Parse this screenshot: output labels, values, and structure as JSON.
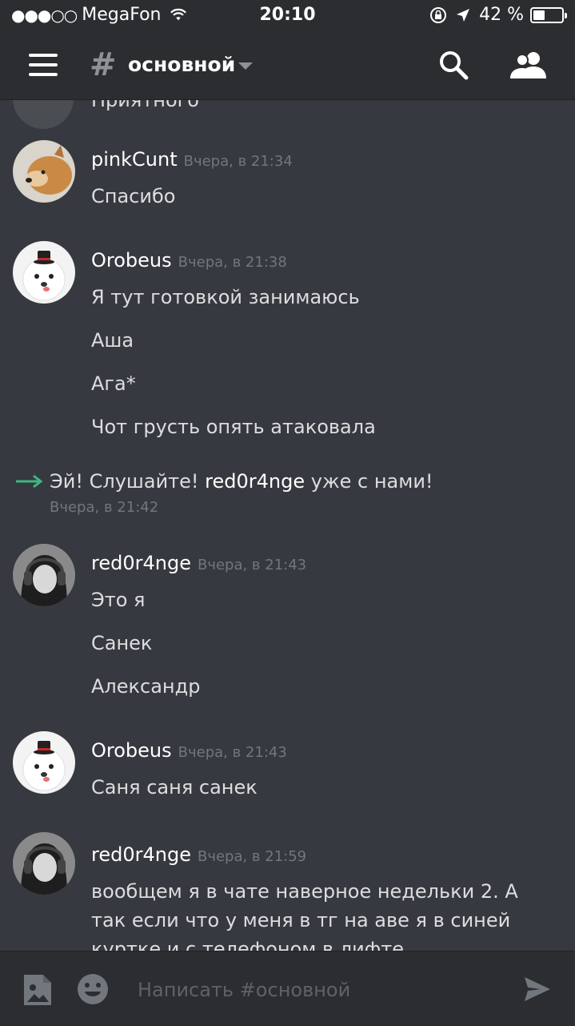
{
  "status_bar": {
    "signal_dots": "●●●○○",
    "carrier": "MegaFon",
    "time": "20:10",
    "battery_text": "42 %",
    "battery_level": 0.42
  },
  "header": {
    "hash": "#",
    "channel_name": "основной",
    "icons": [
      "menu-icon",
      "search-icon",
      "members-icon"
    ]
  },
  "partial_message": "Приятного",
  "messages": [
    {
      "username": "pinkCunt",
      "timestamp": "Вчера, в 21:34",
      "lines": [
        "Спасибо"
      ]
    },
    {
      "username": "Orobeus",
      "timestamp": "Вчера, в 21:38",
      "lines": [
        "Я тут готовкой занимаюсь",
        "Аша",
        "Ага*",
        "Чот грусть опять атаковала"
      ]
    },
    {
      "username": "red0r4nge",
      "timestamp": "Вчера, в 21:43",
      "lines": [
        "Это я",
        "Санек",
        "Александр"
      ]
    },
    {
      "username": "Orobeus",
      "timestamp": "Вчера, в 21:43",
      "lines": [
        "Саня саня санек"
      ]
    },
    {
      "username": "red0r4nge",
      "timestamp": "Вчера, в 21:59",
      "lines": [
        "вообщем я в чате наверное недельки 2. А так если что у меня в тг на аве я в синей куртке и с телефоном в лифте"
      ]
    }
  ],
  "join_message": {
    "before": "Эй! Слушайте! ",
    "username": "red0r4nge",
    "after": " уже с нами!",
    "timestamp": "Вчера, в 21:42"
  },
  "composer": {
    "placeholder": "Написать #основной",
    "icons": [
      "image-icon",
      "emoji-icon",
      "send-icon"
    ]
  },
  "colors": {
    "background": "#36393f",
    "header": "#2b2d31",
    "join_arrow": "#43b581",
    "muted": "#72767d"
  }
}
